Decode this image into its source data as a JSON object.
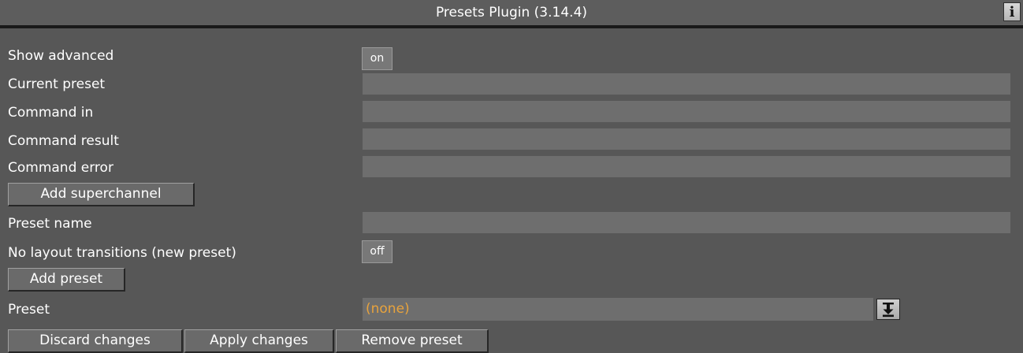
{
  "window": {
    "title": "Presets Plugin (3.14.4)",
    "info_label": "i"
  },
  "rows": {
    "show_advanced": {
      "label": "Show advanced",
      "value": "on"
    },
    "current_preset": {
      "label": "Current preset",
      "value": ""
    },
    "command_in": {
      "label": "Command in",
      "value": ""
    },
    "command_result": {
      "label": "Command result",
      "value": ""
    },
    "command_error": {
      "label": "Command error",
      "value": ""
    },
    "add_superchannel": {
      "label": "Add superchannel"
    },
    "preset_name": {
      "label": "Preset name",
      "value": ""
    },
    "no_layout_transitions": {
      "label": "No layout transitions (new preset)",
      "value": "off"
    },
    "add_preset": {
      "label": "Add preset"
    },
    "preset": {
      "label": "Preset",
      "value": "(none)"
    }
  },
  "footer": {
    "discard_label": "Discard changes",
    "apply_label": "Apply changes",
    "remove_label": "Remove preset"
  },
  "icons": {
    "info": "info-icon",
    "dropdown": "download-arrow-icon"
  },
  "colors": {
    "background": "#575757",
    "field": "#6e6e6e",
    "accent_value": "#e8a33d"
  }
}
